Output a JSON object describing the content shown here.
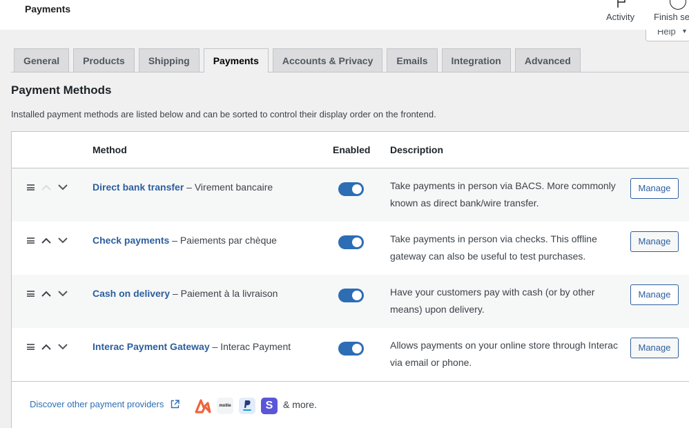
{
  "topbar": {
    "title": "Payments",
    "actions": [
      {
        "label": "Activity",
        "icon": "flag-icon"
      },
      {
        "label": "Finish se",
        "icon": "progress-circle-icon"
      }
    ],
    "help": {
      "label": "Help",
      "icon": "caret-down-icon"
    }
  },
  "tabs": [
    {
      "label": "General",
      "active": false
    },
    {
      "label": "Products",
      "active": false
    },
    {
      "label": "Shipping",
      "active": false
    },
    {
      "label": "Payments",
      "active": true
    },
    {
      "label": "Accounts & Privacy",
      "active": false
    },
    {
      "label": "Emails",
      "active": false
    },
    {
      "label": "Integration",
      "active": false
    },
    {
      "label": "Advanced",
      "active": false
    }
  ],
  "section": {
    "title": "Payment Methods",
    "description": "Installed payment methods are listed below and can be sorted to control their display order on the frontend."
  },
  "table": {
    "headers": {
      "method": "Method",
      "enabled": "Enabled",
      "description": "Description"
    },
    "rows": [
      {
        "name": "Direct bank transfer",
        "subtitle": "– Virement bancaire",
        "enabled": true,
        "description": "Take payments in person via BACS. More commonly known as direct bank/wire transfer.",
        "action": "Manage",
        "can_move_up": false,
        "can_move_down": true
      },
      {
        "name": "Check payments",
        "subtitle": "– Paiements par chèque",
        "enabled": true,
        "description": "Take payments in person via checks. This offline gateway can also be useful to test purchases.",
        "action": "Manage",
        "can_move_up": true,
        "can_move_down": true
      },
      {
        "name": "Cash on delivery",
        "subtitle": "– Paiement à la livraison",
        "enabled": true,
        "description": "Have your customers pay with cash (or by other means) upon delivery.",
        "action": "Manage",
        "can_move_up": true,
        "can_move_down": true
      },
      {
        "name": "Interac Payment Gateway",
        "subtitle": "– Interac Payment",
        "enabled": true,
        "description": "Allows payments on your online store through Interac via email or phone.",
        "action": "Manage",
        "can_move_up": true,
        "can_move_down": true
      }
    ],
    "footer": {
      "discover_label": "Discover other payment providers",
      "logos": [
        "affirm-logo",
        "mollie-logo",
        "paypal-logo",
        "stripe-logo"
      ],
      "mollie_text": "mollie",
      "stripe_text": "S",
      "more_label": "& more."
    }
  },
  "colors": {
    "accent": "#2c6db4",
    "link": "#2c5e9e",
    "background": "#f0f0f1"
  }
}
